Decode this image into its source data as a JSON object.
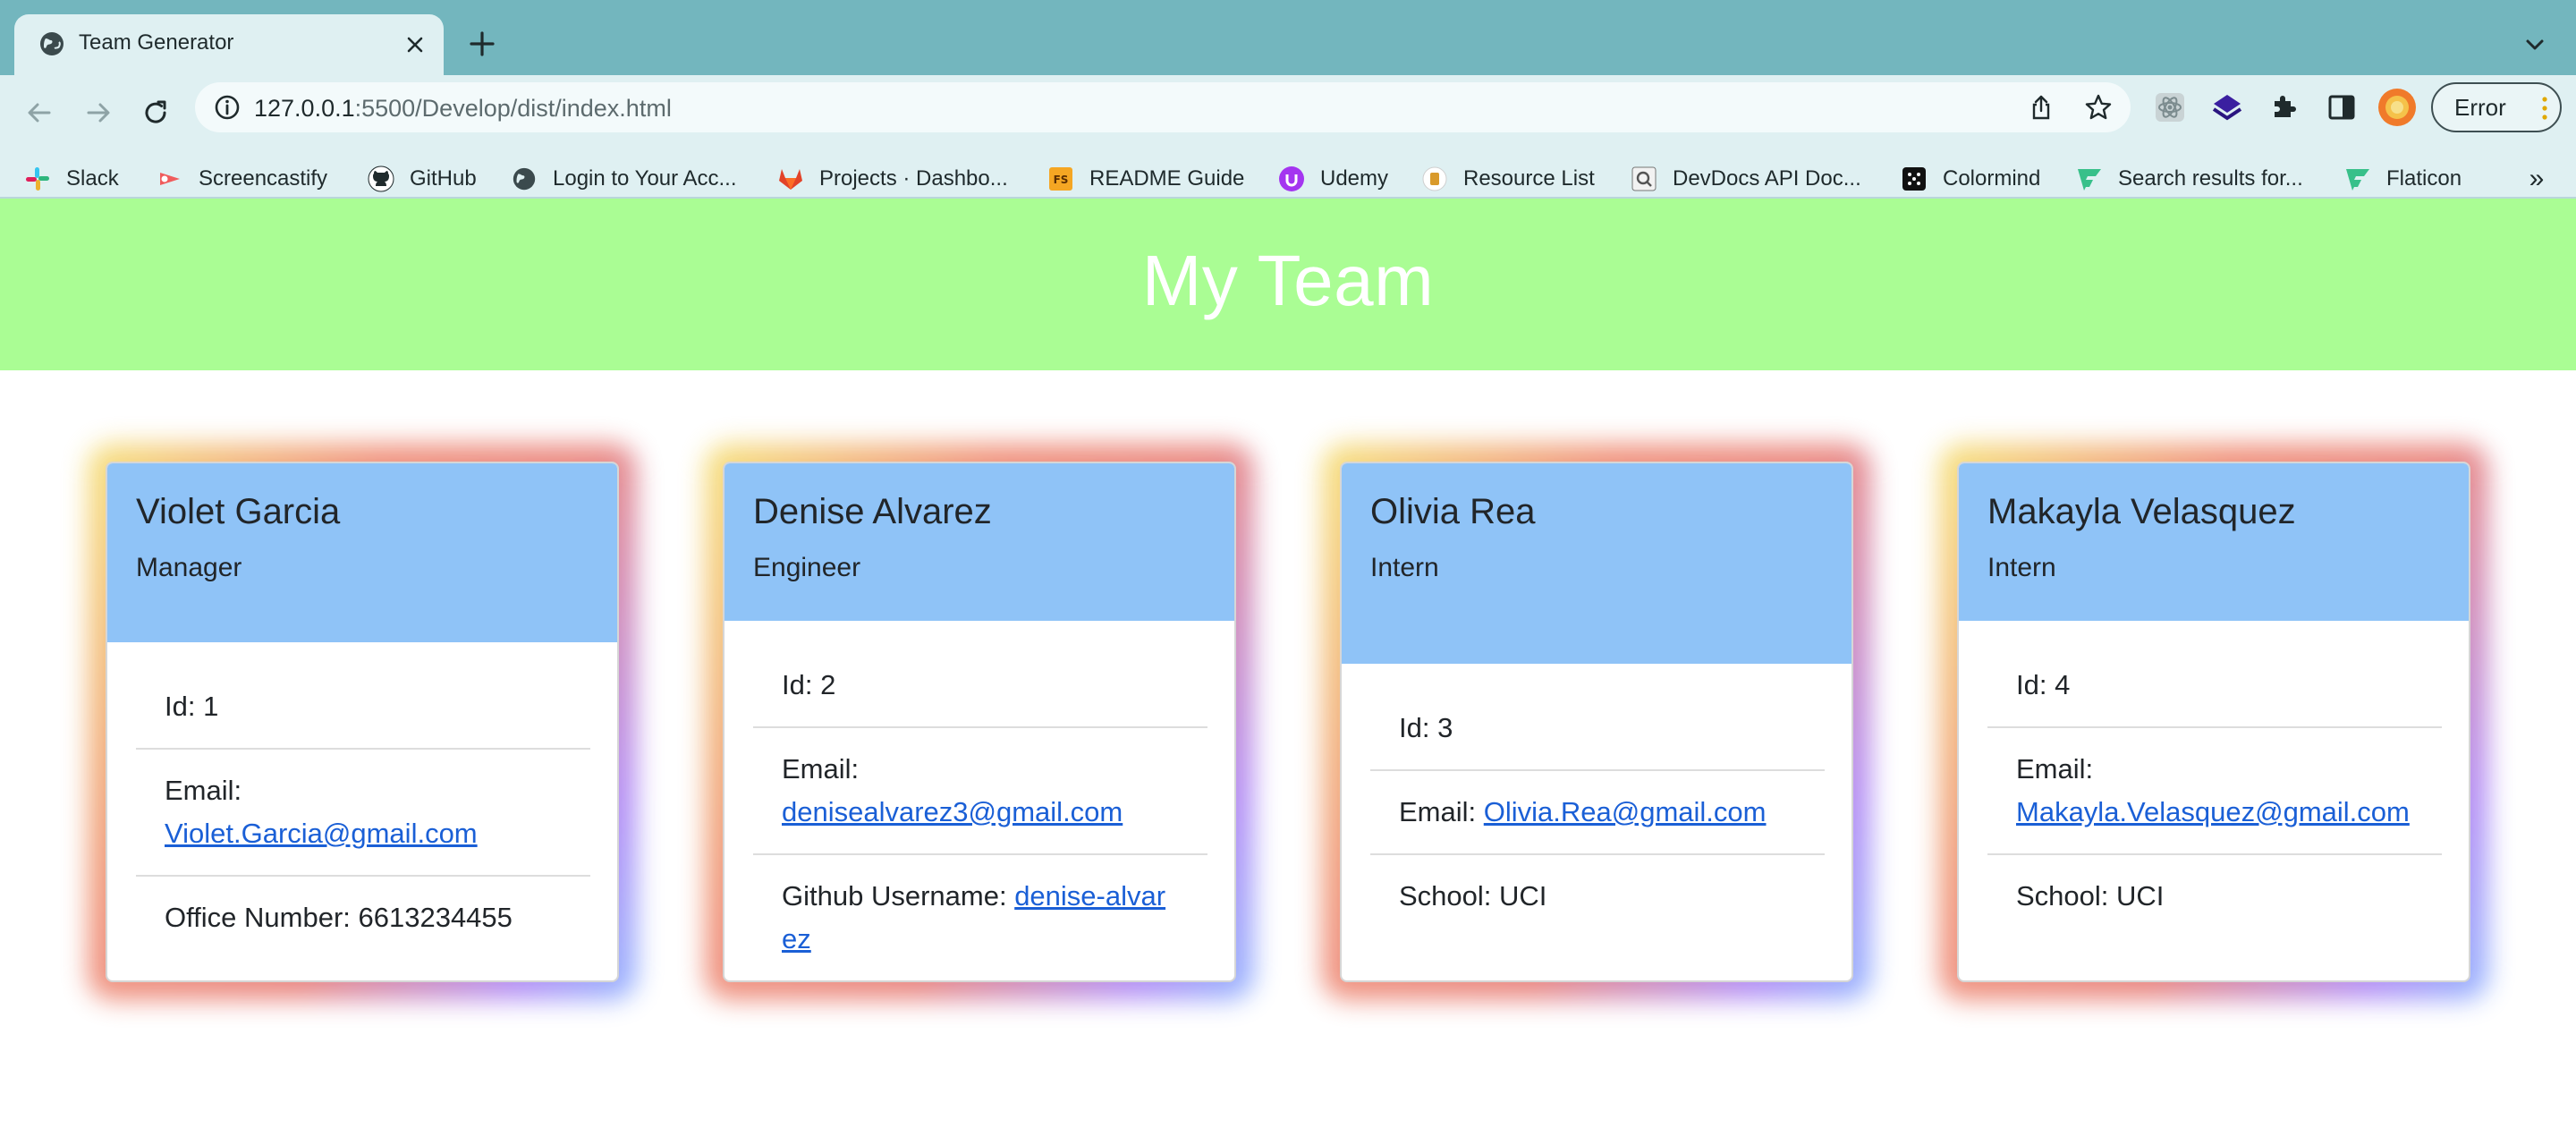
{
  "browser": {
    "tab_title": "Team Generator",
    "url_host": "127.0.0.1",
    "url_path": ":5500/Develop/dist/index.html",
    "profile_button": "Error",
    "bookmarks": [
      {
        "label": "Slack",
        "icon": "slack-icon"
      },
      {
        "label": "Screencastify",
        "icon": "screencastify-icon"
      },
      {
        "label": "GitHub",
        "icon": "github-icon"
      },
      {
        "label": "Login to Your Acc...",
        "icon": "globe-icon"
      },
      {
        "label": "Projects · Dashbo...",
        "icon": "gitlab-icon"
      },
      {
        "label": "README Guide",
        "icon": "fs-icon"
      },
      {
        "label": "Udemy",
        "icon": "udemy-icon"
      },
      {
        "label": "Resource List",
        "icon": "resource-icon"
      },
      {
        "label": "DevDocs API Doc...",
        "icon": "devdocs-icon"
      },
      {
        "label": "Colormind",
        "icon": "colormind-icon"
      },
      {
        "label": "Search results for...",
        "icon": "flaticon-icon"
      },
      {
        "label": "Flaticon",
        "icon": "flaticon-icon"
      }
    ],
    "more_bookmarks": "»"
  },
  "page": {
    "title": "My Team"
  },
  "team": [
    {
      "name": "Violet Garcia",
      "role": "Manager",
      "id_label": "Id: 1",
      "email_label": "Email:",
      "email": "Violet.Garcia@gmail.com",
      "extra_label": "Office Number: 6613234455",
      "extra_link": ""
    },
    {
      "name": "Denise Alvarez",
      "role": "Engineer",
      "id_label": "Id: 2",
      "email_label": "Email:",
      "email": "denisealvarez3@gmail.com",
      "extra_label": "Github Username:",
      "extra_link": "denise-alvarez"
    },
    {
      "name": "Olivia Rea",
      "role": "Intern",
      "id_label": "Id: 3",
      "email_label": "Email:",
      "email": "Olivia.Rea@gmail.com",
      "extra_label": "School: UCI",
      "extra_link": ""
    },
    {
      "name": "Makayla Velasquez",
      "role": "Intern",
      "id_label": "Id: 4",
      "email_label": "Email:",
      "email": "Makayla.Velasquez@gmail.com",
      "extra_label": "School: UCI",
      "extra_link": ""
    }
  ],
  "colors": {
    "header_green": "#aafd94",
    "card_header_blue": "#8fc3f7",
    "link_blue": "#1a5fd6",
    "chrome_teal": "#73b6be"
  }
}
